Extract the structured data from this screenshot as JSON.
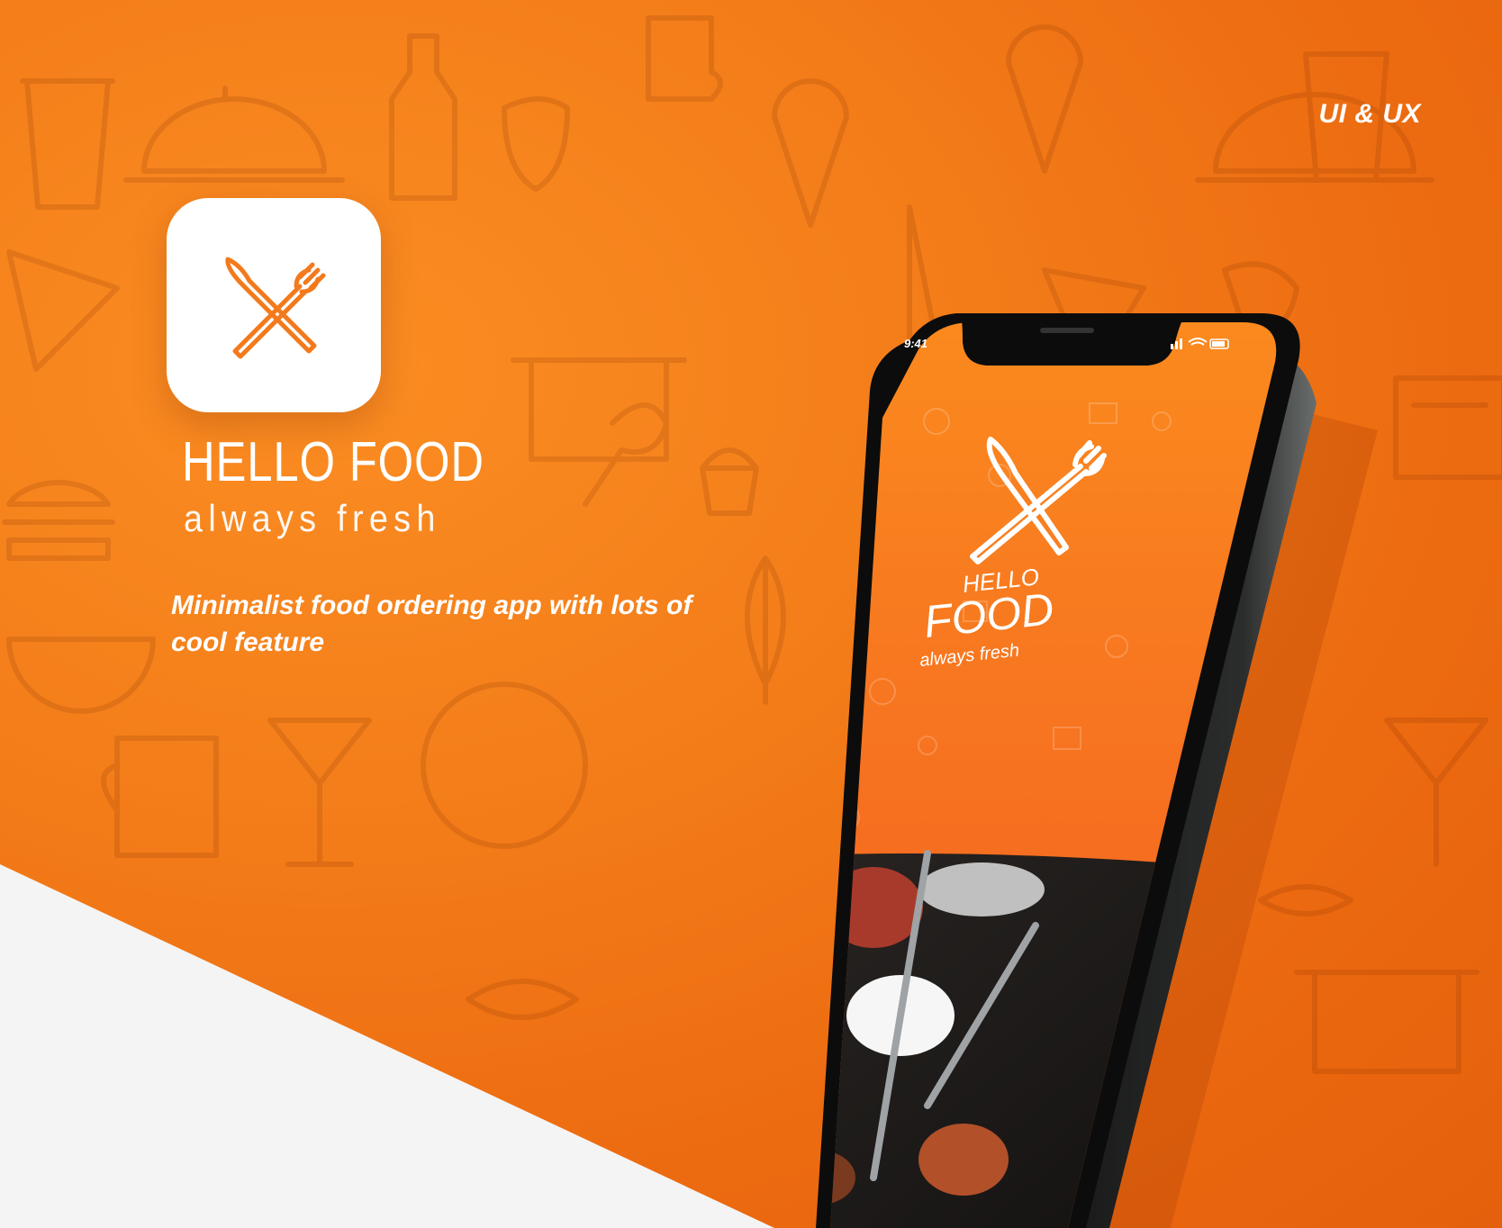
{
  "header": {
    "tag": "UI & UX"
  },
  "brand": {
    "title": "HELLO FOOD",
    "tagline": "always fresh",
    "description": "Minimalist food ordering app with lots of cool feature"
  },
  "phone": {
    "status_time": "9:41",
    "splash": {
      "line1": "HELLO",
      "line2": "FOOD",
      "line3": "always fresh"
    }
  },
  "colors": {
    "accent": "#f47e1a",
    "accent_dark": "#e5600c",
    "white": "#ffffff",
    "light_bg": "#f4f4f4"
  },
  "icons": [
    "fork-knife-icon",
    "signal-icon",
    "wifi-icon",
    "battery-icon"
  ]
}
